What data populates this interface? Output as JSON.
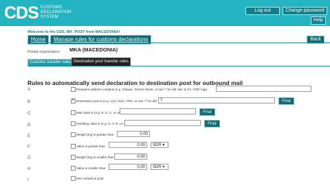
{
  "header": {
    "logo": "CDS",
    "logo_sub_1": "CUSTOMS",
    "logo_sub_2": "DECLARATION",
    "logo_sub_3": "SYSTEM",
    "logout_label": "Log out",
    "change_password_label": "Change password",
    "help_label": "Help",
    "background_color": "#23b3c1"
  },
  "welcome": "Welcome to the CDS, MK_POST from MACEDONIA!",
  "nav": {
    "home_label": "Home",
    "manage_label": "Manage rules for customs declarations",
    "back_label": "Back"
  },
  "org": {
    "label": "Postal organization",
    "value": "MKA (MACEDONIA)"
  },
  "subtabs": {
    "customs": "Customs transfer rules",
    "destination": "Destination post transfer rules"
  },
  "section_title": "Rules to automatically send declaration to destination post for outbound mail",
  "rows": [
    {
      "letter": "A",
      "checked": false,
      "text": "Recipient address contains (e.g. Ottawa, Toronto Brent, or use '!' for all) Use '&' for 'AND' logic",
      "value": ""
    },
    {
      "letter": "B",
      "checked": true,
      "text": "Destination post is (e.g. AUA, NZA, FRA, or use '?' for all)",
      "value": "?",
      "find": "Find"
    },
    {
      "letter": "C",
      "checked": false,
      "text": "Mail class is (e.g. E, U, C, or use '?' for all)",
      "value": "",
      "find": "Find"
    },
    {
      "letter": "D",
      "checked": false,
      "text": "Handling class is (e.g. N, V, R, or use '?' for all)",
      "value": "",
      "find": "Find"
    },
    {
      "letter": "E",
      "checked": false,
      "text": "Weight [Kg] is greater than",
      "value": "0.00"
    },
    {
      "letter": "F",
      "checked": false,
      "text": "Value is greater than",
      "value": "0.00",
      "currency": "SDR"
    },
    {
      "letter": "G",
      "checked": false,
      "text": "Weight [Kg] is smaller than",
      "value": "0.00"
    },
    {
      "letter": "H",
      "checked": false,
      "text": "Value is smaller than",
      "value": "0.00",
      "currency": "SDR"
    },
    {
      "letter": "I",
      "checked": false,
      "text": "Item arrived at post",
      "value": ""
    }
  ]
}
